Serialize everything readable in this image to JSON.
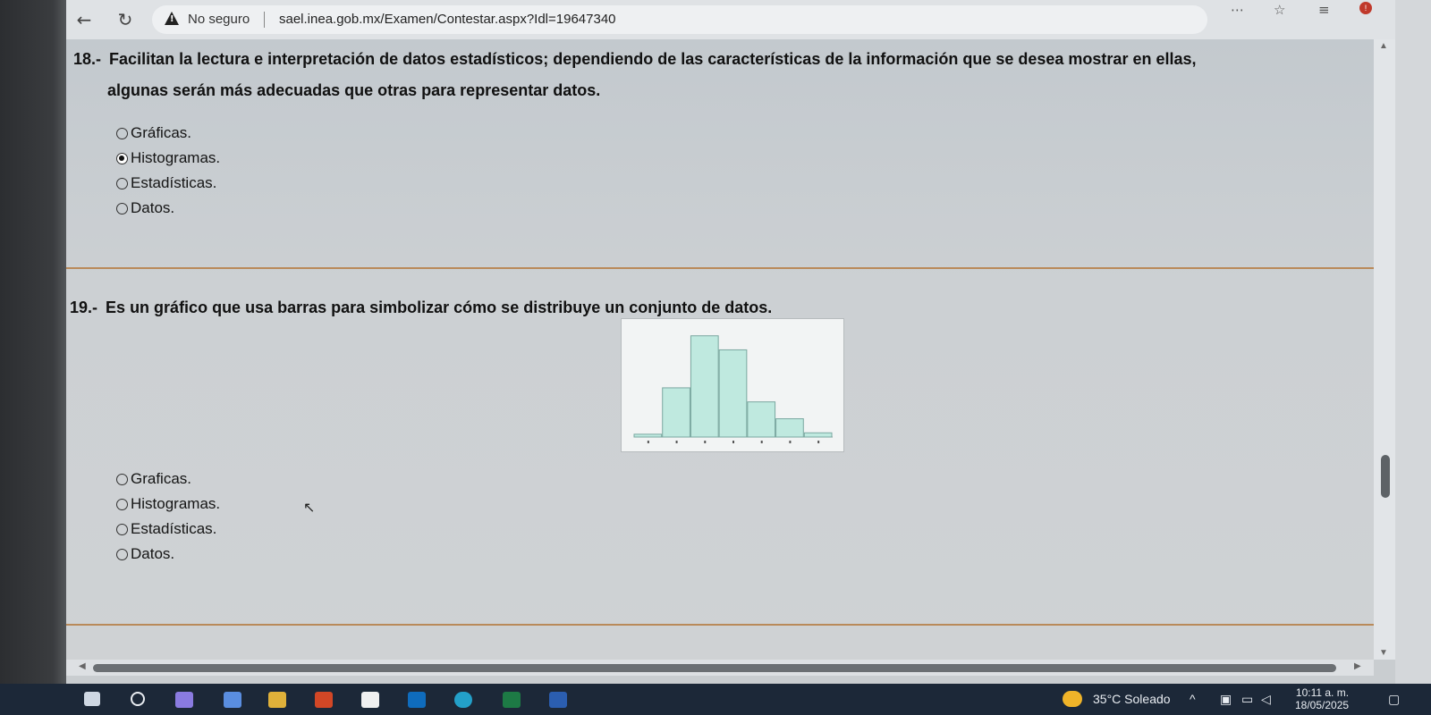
{
  "browser": {
    "security_label": "No seguro",
    "url": "sael.inea.gob.mx/Examen/Contestar.aspx?Idl=19647340"
  },
  "questions": [
    {
      "number": "18.-",
      "text_line1": "Facilitan la lectura e interpretación de datos estadísticos; dependiendo de las características de la información que se desea mostrar en ellas,",
      "text_line2": "algunas serán más adecuadas que otras para representar datos.",
      "options": [
        "Gráficas.",
        "Histogramas.",
        "Estadísticas.",
        "Datos."
      ],
      "selected": 1
    },
    {
      "number": "19.-",
      "text_line1": "Es un gráfico que usa barras para simbolizar cómo se distribuye un conjunto de datos.",
      "options": [
        "Graficas.",
        "Histogramas.",
        "Estadísticas.",
        "Datos."
      ],
      "selected": null
    }
  ],
  "chart_data": {
    "type": "bar",
    "title": "",
    "xlabel": "",
    "ylabel": "",
    "values": [
      2,
      35,
      72,
      62,
      25,
      13,
      3
    ],
    "ylim": [
      0,
      75
    ],
    "grid": false,
    "bar_color": "#bfe9df"
  },
  "taskbar": {
    "weather": "35°C  Soleado",
    "time": "10:11 a. m.",
    "date": "18/05/2025"
  },
  "colors": {
    "divider": "#b98a5a",
    "taskbar": "#1c2838"
  }
}
